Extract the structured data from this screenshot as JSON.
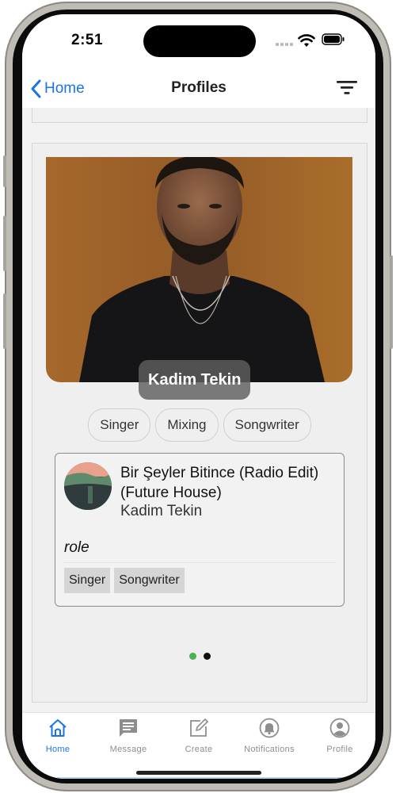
{
  "status_bar": {
    "time": "2:51"
  },
  "nav": {
    "back_label": "Home",
    "title": "Profiles"
  },
  "profile": {
    "name": "Kadim Tekin",
    "roles": [
      "Singer",
      "Mixing",
      "Songwriter"
    ]
  },
  "song": {
    "title": "Bir Şeyler Bitince (Radio Edit) (Future House)",
    "artist": "Kadim Tekin",
    "role_heading": "role",
    "roles": [
      "Singer",
      "Songwriter"
    ]
  },
  "pagination": {
    "total": 2,
    "active_index": 0,
    "active_color": "#4caf50",
    "inactive_color": "#111111"
  },
  "tab_bar": {
    "items": [
      {
        "label": "Home",
        "icon": "home-icon",
        "active": true
      },
      {
        "label": "Message",
        "icon": "message-icon",
        "active": false
      },
      {
        "label": "Create",
        "icon": "create-icon",
        "active": false
      },
      {
        "label": "Notifications",
        "icon": "bell-icon",
        "active": false
      },
      {
        "label": "Profile",
        "icon": "person-icon",
        "active": false
      }
    ]
  },
  "colors": {
    "accent": "#1a73e8",
    "background": "#f2f2f2"
  }
}
